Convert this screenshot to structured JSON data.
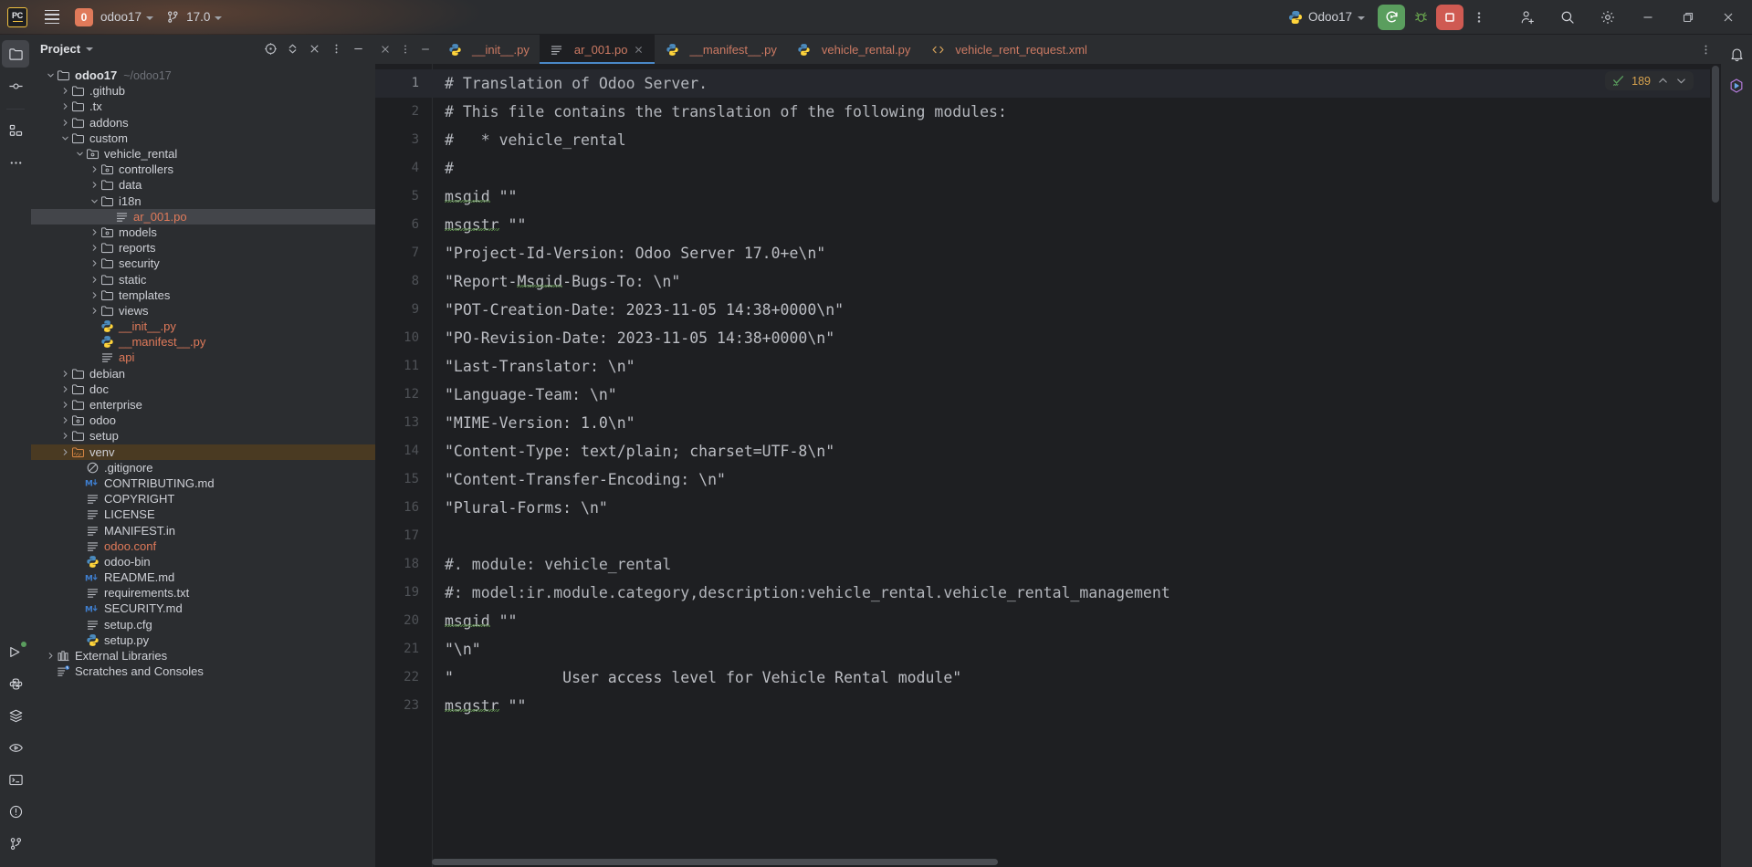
{
  "titlebar": {
    "logo_text": "PC",
    "menu_icon": "hamburger-icon",
    "project_badge": "0",
    "project_name": "odoo17",
    "branch_name": "17.0",
    "run_config_name": "Odoo17",
    "run_icon": "rerun-icon",
    "debug_icon": "bug-icon",
    "stop_icon": "stop-icon",
    "more_icon": "more-vertical-icon",
    "add_user_icon": "add-user-icon",
    "search_icon": "search-icon",
    "settings_icon": "gear-icon",
    "minimize_icon": "minimize-icon",
    "maximize_icon": "maximize-icon",
    "close_icon": "close-icon"
  },
  "left_rail": {
    "items": [
      {
        "name": "project-tool-icon",
        "active": true
      },
      {
        "name": "commit-tool-icon",
        "active": false
      },
      {
        "name": "structure-tool-icon",
        "active": false
      },
      {
        "name": "more-tool-icon",
        "active": false
      }
    ],
    "bottom_items": [
      {
        "name": "run-tool-icon"
      },
      {
        "name": "python-packages-icon"
      },
      {
        "name": "services-icon"
      },
      {
        "name": "debug-tool-icon"
      },
      {
        "name": "terminal-icon"
      },
      {
        "name": "problems-icon"
      },
      {
        "name": "version-control-icon"
      }
    ]
  },
  "right_rail": {
    "items": [
      {
        "name": "notifications-icon"
      },
      {
        "name": "ai-assistant-icon"
      }
    ]
  },
  "project_panel": {
    "title": "Project",
    "title_chevron": "chevron-down-icon",
    "actions": [
      {
        "name": "select-opened-file-icon"
      },
      {
        "name": "expand-collapse-icon"
      },
      {
        "name": "hide-icon"
      },
      {
        "name": "options-icon"
      },
      {
        "name": "minimize-panel-icon"
      }
    ],
    "tree": [
      {
        "depth": 0,
        "arrow": "down",
        "icon": "folder",
        "label": "odoo17",
        "bold": true,
        "path": "~/odoo17"
      },
      {
        "depth": 1,
        "arrow": "right",
        "icon": "folder",
        "label": ".github"
      },
      {
        "depth": 1,
        "arrow": "right",
        "icon": "folder",
        "label": ".tx"
      },
      {
        "depth": 1,
        "arrow": "right",
        "icon": "folder",
        "label": "addons"
      },
      {
        "depth": 1,
        "arrow": "down",
        "icon": "folder",
        "label": "custom"
      },
      {
        "depth": 2,
        "arrow": "down",
        "icon": "package",
        "label": "vehicle_rental"
      },
      {
        "depth": 3,
        "arrow": "right",
        "icon": "package",
        "label": "controllers"
      },
      {
        "depth": 3,
        "arrow": "right",
        "icon": "folder",
        "label": "data"
      },
      {
        "depth": 3,
        "arrow": "down",
        "icon": "folder",
        "label": "i18n"
      },
      {
        "depth": 4,
        "arrow": "none",
        "icon": "text",
        "label": "ar_001.po",
        "modified": true,
        "selected": true
      },
      {
        "depth": 3,
        "arrow": "right",
        "icon": "package",
        "label": "models"
      },
      {
        "depth": 3,
        "arrow": "right",
        "icon": "folder",
        "label": "reports"
      },
      {
        "depth": 3,
        "arrow": "right",
        "icon": "folder",
        "label": "security"
      },
      {
        "depth": 3,
        "arrow": "right",
        "icon": "folder",
        "label": "static"
      },
      {
        "depth": 3,
        "arrow": "right",
        "icon": "folder",
        "label": "templates"
      },
      {
        "depth": 3,
        "arrow": "right",
        "icon": "folder",
        "label": "views"
      },
      {
        "depth": 3,
        "arrow": "none",
        "icon": "python",
        "label": "__init__.py",
        "modified": true
      },
      {
        "depth": 3,
        "arrow": "none",
        "icon": "python",
        "label": "__manifest__.py",
        "modified": true
      },
      {
        "depth": 3,
        "arrow": "none",
        "icon": "text",
        "label": "api",
        "modified": true
      },
      {
        "depth": 1,
        "arrow": "right",
        "icon": "folder",
        "label": "debian"
      },
      {
        "depth": 1,
        "arrow": "right",
        "icon": "folder",
        "label": "doc"
      },
      {
        "depth": 1,
        "arrow": "right",
        "icon": "folder",
        "label": "enterprise"
      },
      {
        "depth": 1,
        "arrow": "right",
        "icon": "package",
        "label": "odoo"
      },
      {
        "depth": 1,
        "arrow": "right",
        "icon": "folder",
        "label": "setup"
      },
      {
        "depth": 1,
        "arrow": "right",
        "icon": "excluded",
        "label": "venv",
        "highlight": true
      },
      {
        "depth": 2,
        "arrow": "none",
        "icon": "gitignore",
        "label": ".gitignore"
      },
      {
        "depth": 2,
        "arrow": "none",
        "icon": "markdown",
        "label": "CONTRIBUTING.md"
      },
      {
        "depth": 2,
        "arrow": "none",
        "icon": "text",
        "label": "COPYRIGHT"
      },
      {
        "depth": 2,
        "arrow": "none",
        "icon": "text",
        "label": "LICENSE"
      },
      {
        "depth": 2,
        "arrow": "none",
        "icon": "text",
        "label": "MANIFEST.in"
      },
      {
        "depth": 2,
        "arrow": "none",
        "icon": "text",
        "label": "odoo.conf",
        "modified": true
      },
      {
        "depth": 2,
        "arrow": "none",
        "icon": "python",
        "label": "odoo-bin"
      },
      {
        "depth": 2,
        "arrow": "none",
        "icon": "markdown",
        "label": "README.md"
      },
      {
        "depth": 2,
        "arrow": "none",
        "icon": "text",
        "label": "requirements.txt"
      },
      {
        "depth": 2,
        "arrow": "none",
        "icon": "markdown",
        "label": "SECURITY.md"
      },
      {
        "depth": 2,
        "arrow": "none",
        "icon": "text",
        "label": "setup.cfg"
      },
      {
        "depth": 2,
        "arrow": "none",
        "icon": "python",
        "label": "setup.py"
      },
      {
        "depth": 0,
        "arrow": "right",
        "icon": "library",
        "label": "External Libraries"
      },
      {
        "depth": 0,
        "arrow": "none",
        "icon": "scratch",
        "label": "Scratches and Consoles"
      }
    ]
  },
  "editor": {
    "tab_tools": [
      {
        "name": "close-all-tabs-icon"
      },
      {
        "name": "tab-options-icon"
      },
      {
        "name": "hide-tabs-icon"
      }
    ],
    "tabs": [
      {
        "label": "__init__.py",
        "icon": "python",
        "active": false,
        "closable": false
      },
      {
        "label": "ar_001.po",
        "icon": "text",
        "active": true,
        "closable": true
      },
      {
        "label": "__manifest__.py",
        "icon": "python",
        "active": false,
        "closable": false
      },
      {
        "label": "vehicle_rental.py",
        "icon": "python",
        "active": false,
        "closable": false
      },
      {
        "label": "vehicle_rent_request.xml",
        "icon": "xml",
        "active": false,
        "closable": false
      }
    ],
    "tabbar_more_icon": "editor-more-icon",
    "inspection": {
      "status_icon": "inspection-ok-icon",
      "count": "189",
      "prev_icon": "chevron-up-icon",
      "next_icon": "chevron-down-icon"
    },
    "lines": [
      {
        "n": "1",
        "text": "# Translation of Odoo Server.",
        "kind": "comment",
        "current": true
      },
      {
        "n": "2",
        "text": "# This file contains the translation of the following modules:",
        "kind": "comment"
      },
      {
        "n": "3",
        "text": "#\t* vehicle_rental",
        "kind": "comment"
      },
      {
        "n": "4",
        "text": "#",
        "kind": "comment"
      },
      {
        "n": "5",
        "text": "msgid \"\"",
        "kind": "code",
        "squiggle": "msgid"
      },
      {
        "n": "6",
        "text": "msgstr \"\"",
        "kind": "code",
        "squiggle": "msgstr"
      },
      {
        "n": "7",
        "text": "\"Project-Id-Version: Odoo Server 17.0+e\\n\"",
        "kind": "code"
      },
      {
        "n": "8",
        "text": "\"Report-Msgid-Bugs-To: \\n\"",
        "kind": "code",
        "squiggle": "Msgid",
        "sq_start": 8
      },
      {
        "n": "9",
        "text": "\"POT-Creation-Date: 2023-11-05 14:38+0000\\n\"",
        "kind": "code"
      },
      {
        "n": "10",
        "text": "\"PO-Revision-Date: 2023-11-05 14:38+0000\\n\"",
        "kind": "code"
      },
      {
        "n": "11",
        "text": "\"Last-Translator: \\n\"",
        "kind": "code"
      },
      {
        "n": "12",
        "text": "\"Language-Team: \\n\"",
        "kind": "code"
      },
      {
        "n": "13",
        "text": "\"MIME-Version: 1.0\\n\"",
        "kind": "code"
      },
      {
        "n": "14",
        "text": "\"Content-Type: text/plain; charset=UTF-8\\n\"",
        "kind": "code"
      },
      {
        "n": "15",
        "text": "\"Content-Transfer-Encoding: \\n\"",
        "kind": "code"
      },
      {
        "n": "16",
        "text": "\"Plural-Forms: \\n\"",
        "kind": "code"
      },
      {
        "n": "17",
        "text": "",
        "kind": "code"
      },
      {
        "n": "18",
        "text": "#. module: vehicle_rental",
        "kind": "comment"
      },
      {
        "n": "19",
        "text": "#: model:ir.module.category,description:vehicle_rental.vehicle_rental_management",
        "kind": "comment"
      },
      {
        "n": "20",
        "text": "msgid \"\"",
        "kind": "code",
        "squiggle": "msgid"
      },
      {
        "n": "21",
        "text": "\"\\n\"",
        "kind": "code"
      },
      {
        "n": "22",
        "text": "\"            User access level for Vehicle Rental module\"",
        "kind": "code"
      },
      {
        "n": "23",
        "text": "msgstr \"\"",
        "kind": "code",
        "squiggle": "msgstr"
      }
    ]
  },
  "colors": {
    "accent_orange": "#e07a5a",
    "tab_active_underline": "#4a88c7",
    "run_green": "#5a9e5e",
    "stop_red": "#cf5a52",
    "inspection_amber": "#d6a24e",
    "editor_bg": "#1e1f22",
    "panel_bg": "#2b2d30"
  }
}
